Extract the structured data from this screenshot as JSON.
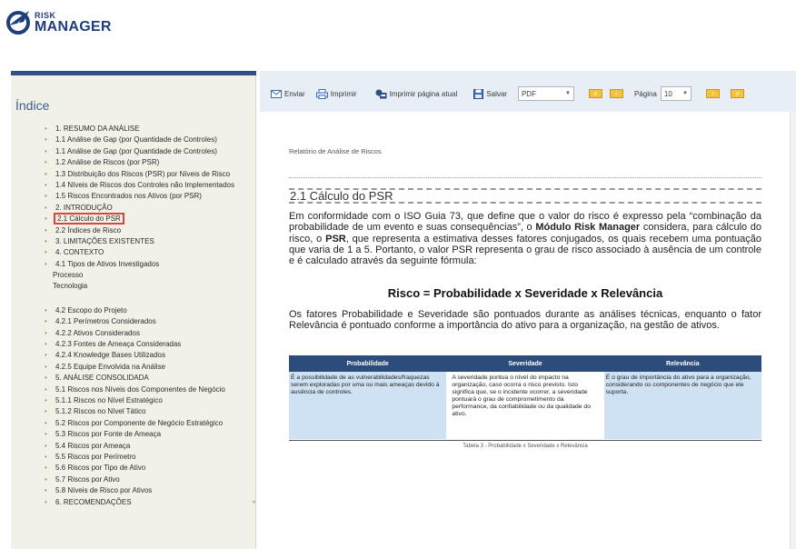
{
  "app": {
    "logo_small": "RISK",
    "logo_big": "MANAGER"
  },
  "sidebar": {
    "title": "Índice",
    "items": [
      {
        "label": "1. RESUMO DA ANÁLISE",
        "bullet": true
      },
      {
        "label": "1.1 Análise de Gap (por Quantidade de Controles)",
        "bullet": true
      },
      {
        "label": "1.1 Análise de Gap (por Quantidade de Controles)",
        "bullet": true
      },
      {
        "label": "1.2 Análise de Riscos (por PSR)",
        "bullet": true
      },
      {
        "label": "1.3 Distribuição dos Riscos (PSR) por Níveis de Risco",
        "bullet": true
      },
      {
        "label": "1.4 Níveis de Riscos dos Controles não Implementados",
        "bullet": true
      },
      {
        "label": "1.5 Riscos Encontrados nos Ativos (por PSR)",
        "bullet": true
      },
      {
        "label": "2. INTRODUÇÃO",
        "bullet": true
      },
      {
        "label": "2.1 Cálculo do PSR",
        "bullet": true,
        "selected": true
      },
      {
        "label": "2.2 Índices de Risco",
        "bullet": true
      },
      {
        "label": "3. LIMITAÇÕES EXISTENTES",
        "bullet": true
      },
      {
        "label": "4. CONTEXTO",
        "bullet": true
      },
      {
        "label": "4.1 Tipos de Ativos Investigados",
        "bullet": true
      },
      {
        "label": "Processo",
        "bullet": false
      },
      {
        "label": "Tecnologia",
        "bullet": false
      },
      {
        "label": "",
        "spacer": true
      },
      {
        "label": "4.2 Escopo do Projeto",
        "bullet": true
      },
      {
        "label": "4.2.1 Perímetros Considerados",
        "bullet": true
      },
      {
        "label": "4.2.2 Ativos Considerados",
        "bullet": true
      },
      {
        "label": "4.2.3 Fontes de Ameaça Consideradas",
        "bullet": true
      },
      {
        "label": "4.2.4 Knowledge Bases Utilizados",
        "bullet": true
      },
      {
        "label": "4.2.5 Equipe Envolvida na Análise",
        "bullet": true
      },
      {
        "label": "5. ANÁLISE CONSOLIDADA",
        "bullet": true
      },
      {
        "label": "5.1 Riscos nos Níveis dos Componentes de Negócio",
        "bullet": true
      },
      {
        "label": "5.1.1 Riscos no Nível Estratégico",
        "bullet": true
      },
      {
        "label": "5.1.2 Riscos no Nível Tático",
        "bullet": true
      },
      {
        "label": "5.2 Riscos por Componente de Negócio Estratégico",
        "bullet": true
      },
      {
        "label": "5.3 Riscos por Fonte de Ameaça",
        "bullet": true
      },
      {
        "label": "5.4 Riscos por Ameaça",
        "bullet": true
      },
      {
        "label": "5.5 Riscos por Perímetro",
        "bullet": true
      },
      {
        "label": "5.6 Riscos por Tipo de Ativo",
        "bullet": true
      },
      {
        "label": "5.7 Riscos por Ativo",
        "bullet": true
      },
      {
        "label": "5.8 Níveis de Risco por Ativos",
        "bullet": true
      },
      {
        "label": "6. RECOMENDAÇÕES",
        "bullet": true
      }
    ]
  },
  "toolbar": {
    "send_label": "Enviar",
    "print_label": "Imprimir",
    "print_page_label": "Imprimir página atual",
    "save_label": "Salvar",
    "format_value": "PDF",
    "page_label": "Página",
    "page_value": "10"
  },
  "document": {
    "header": "Relatório de Análise de Riscos",
    "section_title": "2.1 Cálculo do PSR",
    "para1_a": "Em conformidade com o ISO Guia 73, que define que o valor do risco é expresso pela “combinação da probabilidade de um evento e suas consequências”, o ",
    "para1_b": "Módulo Risk Manager",
    "para1_c": " considera, para cálculo do risco, o ",
    "para1_d": "PSR",
    "para1_e": ", que representa a estimativa desses fatores conjugados, os quais recebem uma pontuação que varia de 1 a 5. Portanto, o valor PSR representa o grau de risco associado à ausência de um controle e é calculado através da seguinte fórmula:",
    "formula": "Risco = Probabilidade x Severidade x Relevância",
    "para2": "Os fatores Probabilidade e Severidade são pontuados durante as análises técnicas, enquanto o fator Relevância é pontuado conforme a importância do ativo para a organização, na gestão de ativos.",
    "table": {
      "headers": [
        "Probabilidade",
        "Severidade",
        "Relevância"
      ],
      "cells": [
        "É a possibilidade de as vulnerabilidades/fraquezas serem exploradas por uma ou mais ameaças devido à ausência de controles.",
        "A severidade pontua o nível do impacto na organização, caso ocorra o risco previsto. Isto significa que, se o incidente ocorrer, a severidade pontuará o grau de comprometimento da performance, da confiabilidade ou da qualidade do ativo.",
        "É o grau de importância do ativo para a organização, considerando os componentes de negócio que ele suporta."
      ]
    },
    "caption": "Tabela 3 - Probabilidade x Severidade x Relevância"
  },
  "colors": {
    "brand": "#1f3f7a",
    "sidebar_bg": "#f1f1e8",
    "selection_outline": "#e0433f",
    "table_header": "#2c4c7c",
    "table_cell": "#cfe2f3"
  }
}
